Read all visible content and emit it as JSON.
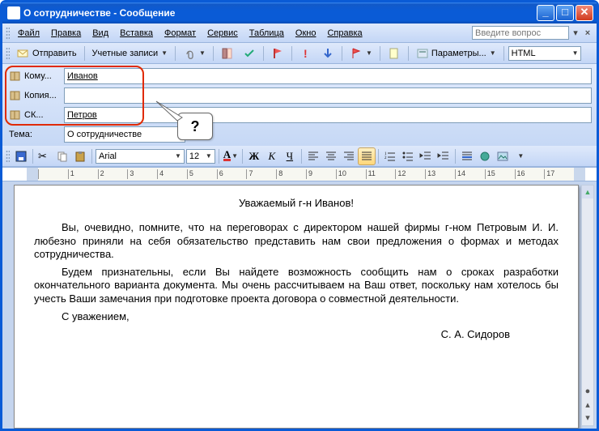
{
  "window": {
    "title": "О сотрудничестве - Сообщение"
  },
  "menu": {
    "items": [
      "Файл",
      "Правка",
      "Вид",
      "Вставка",
      "Формат",
      "Сервис",
      "Таблица",
      "Окно",
      "Справка"
    ],
    "help_placeholder": "Введите вопрос"
  },
  "toolbar": {
    "send": "Отправить",
    "accounts": "Учетные записи",
    "params": "Параметры...",
    "format_select": "HTML"
  },
  "address": {
    "to_label": "Кому...",
    "to_value": "Иванов",
    "cc_label": "Копия...",
    "cc_value": "",
    "bcc_label": "СК...",
    "bcc_value": "Петров",
    "subject_label": "Тема:",
    "subject_value": "О сотрудничестве",
    "callout": "?"
  },
  "format": {
    "font_name": "Arial",
    "font_size": "12"
  },
  "ruler": {
    "ticks": [
      "",
      "1",
      "2",
      "3",
      "4",
      "5",
      "6",
      "7",
      "8",
      "9",
      "10",
      "11",
      "12",
      "13",
      "14",
      "15",
      "16",
      "17"
    ]
  },
  "body": {
    "greeting": "Уважаемый г-н Иванов!",
    "p1": "Вы, очевидно, помните, что на переговорах с директором нашей фирмы г-ном Петровым И. И. любезно приняли на себя обязательство представить нам свои предложения о формах и методах сотрудничества.",
    "p2": "Будем признательны, если Вы найдете возможность сообщить нам о сроках разработки окончательного варианта документа. Мы очень рассчитываем на Ваш ответ, поскольку нам хотелось бы учесть Ваши замечания при подготовке проекта договора о совместной деятельности.",
    "p3": "С уважением,",
    "signature": "С. А. Сидоров"
  }
}
